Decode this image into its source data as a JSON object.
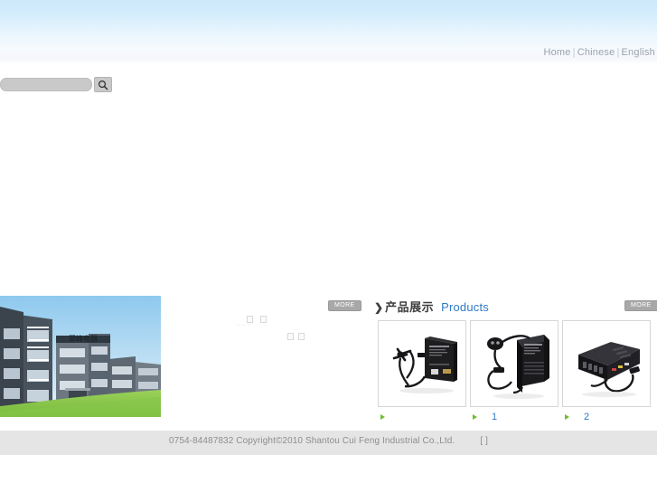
{
  "header": {
    "nav": [
      {
        "label": "Home"
      },
      {
        "label": "Chinese"
      },
      {
        "label": "English"
      }
    ],
    "separator": "|"
  },
  "search": {
    "value": "",
    "placeholder": "",
    "icon": "search-icon",
    "button_label": ""
  },
  "hero": {
    "photo_alt": "factory-building"
  },
  "products_section": {
    "more_left_label": "MORE",
    "more_right_label": "MORE",
    "arrow": "❯",
    "title_cn": "产品展示",
    "title_en": "Products",
    "items": [
      {
        "caption": "",
        "alt": "black-power-adapter-with-cable"
      },
      {
        "caption": "1",
        "alt": "black-transformer-with-plug-and-cable"
      },
      {
        "caption": "2",
        "alt": "black-device-box-with-cable"
      }
    ]
  },
  "footer": {
    "text": "0754-84487832 Copyright©2010 Shantou Cui Feng Industrial Co.,Ltd.",
    "brackets": "[   ]"
  },
  "colors": {
    "header_top": "#cde9fb",
    "link_gray": "#9aa3ac",
    "accent_blue": "#2f79c7",
    "bullet_green": "#6fbd2f",
    "more_gray": "#a8a8a8",
    "footer_bg": "#e5e5e5",
    "footer_text": "#8d8d8d"
  }
}
